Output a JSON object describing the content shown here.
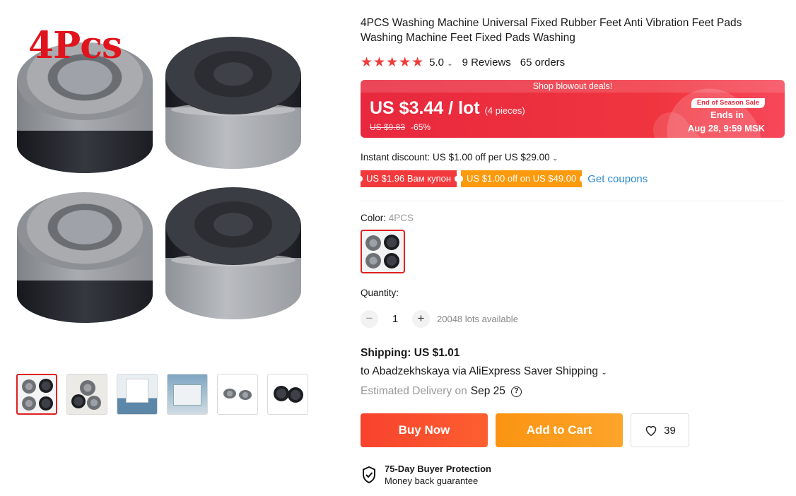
{
  "gallery": {
    "promo_label": "4Pcs",
    "thumbnail_count": 6
  },
  "product": {
    "title": "4PCS Washing Machine Universal Fixed Rubber Feet Anti Vibration Feet Pads Washing Machine Feet Fixed Pads Washing",
    "stars": "★★★★★",
    "rating": "5.0",
    "reviews": "9 Reviews",
    "orders": "65 orders"
  },
  "price": {
    "banner": "Shop blowout deals!",
    "current": "US $3.44 / lot",
    "unit": "(4 pieces)",
    "original": "US $9.83",
    "discount": "-65%",
    "sale_tag": "End of Season Sale",
    "ends_in": "Ends in",
    "ends_date": "Aug 28, 9:59 MSK",
    "accent_color": "#e8283e"
  },
  "discounts": {
    "instant": "Instant discount: US $1.00 off per US $29.00",
    "coupon_1": "US $1.96 Вам купон",
    "coupon_2": "US $1.00 off on US $49.00",
    "get_coupons": "Get coupons"
  },
  "variant": {
    "label": "Color:",
    "value": "4PCS"
  },
  "quantity": {
    "label": "Quantity:",
    "minus": "−",
    "value": "1",
    "plus": "+",
    "available": "20048 lots available"
  },
  "shipping": {
    "cost": "Shipping: US $1.01",
    "to": "to Abadzekhskaya via AliExpress Saver Shipping",
    "estimated_label": "Estimated Delivery on",
    "estimated_date": "Sep 25",
    "help": "?"
  },
  "actions": {
    "buy_now": "Buy Now",
    "add_to_cart": "Add to Cart",
    "wishlist_count": "39"
  },
  "protection": {
    "title": "75-Day Buyer Protection",
    "subtitle": "Money back guarantee"
  }
}
